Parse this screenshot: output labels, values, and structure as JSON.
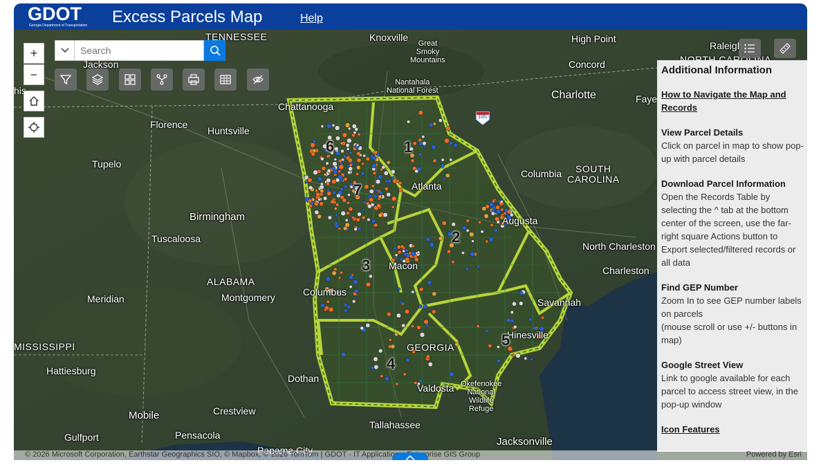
{
  "header": {
    "logo_text": "GDOT",
    "logo_sub": "Georgia Department of Transportation",
    "title": "Excess Parcels Map",
    "help_label": "Help"
  },
  "search": {
    "placeholder": "Search"
  },
  "zoom": {
    "in_label": "+",
    "out_label": "−"
  },
  "toolbar": {
    "tools": [
      "filter-icon",
      "layers-icon",
      "basemap-gallery-icon",
      "share-icon",
      "print-icon",
      "table-icon",
      "visibility-icon"
    ],
    "right_tools": [
      "list-icon",
      "measure-icon"
    ]
  },
  "map": {
    "cities": {
      "tennessee": "TENNESSEE",
      "knoxville": "Knoxville",
      "great_smoky": "Great\nSmoky\nMountains",
      "high_point": "High Point",
      "raleigh": "Raleigh",
      "north_carolina": "NORTH CAROLINA",
      "jackson": "Jackson",
      "concord": "Concord",
      "nantahala": "Nantahala\nNational Forest",
      "charlotte": "Charlotte",
      "fayetteville": "Faye",
      "chattanooga": "Chattanooga",
      "florence": "Florence",
      "huntsville": "Huntsville",
      "tupelo": "Tupelo",
      "columbia": "Columbia",
      "south_carolina": "SOUTH\nCAROLINA",
      "atlanta": "Atlanta",
      "birmingham": "Birmingham",
      "augusta": "Augusta",
      "tuscaloosa": "Tuscaloosa",
      "north_charleston": "North Charleston",
      "macon": "Macon",
      "charleston": "Charleston",
      "alabama": "ALABAMA",
      "montgomery": "Montgomery",
      "columbus": "Columbus",
      "meridian": "Meridian",
      "savannah": "Savannah",
      "mississippi": "MISSISSIPPI",
      "hinesville": "Hinesville",
      "georgia": "GEORGIA",
      "hattiesburg": "Hattiesburg",
      "dothan": "Dothan",
      "valdosta": "Valdosta",
      "okefenokee": "Okefenokee\nNational\nWildlife\nRefuge",
      "mobile": "Mobile",
      "crestview": "Crestview",
      "gulfport": "Gulfport",
      "pensacola": "Pensacola",
      "tallahassee": "Tallahassee",
      "jacksonville": "Jacksonville",
      "panama_city": "Panama City",
      "this": "his",
      "interstate": "185"
    },
    "districts": [
      "1",
      "2",
      "3",
      "4",
      "5",
      "6",
      "7"
    ]
  },
  "panel": {
    "title": "Additional Information",
    "nav_link": "How to Navigate the Map and Records",
    "sections": [
      {
        "heading": "View Parcel Details",
        "body": "Click on parcel in map to show pop-up with parcel details"
      },
      {
        "heading": "Download Parcel Information",
        "body": "Open the Records Table by selecting the ^ tab at the bottom center of the screen, use the far-right square Actions button to Export selected/filtered records or all data"
      },
      {
        "heading": "Find GEP Number",
        "body": "Zoom In to see GEP number labels on parcels\n(mouse scroll or use +/- buttons in map)"
      },
      {
        "heading": "Google Street View",
        "body": "Link to google available for each parcel to access street view, in the pop-up window"
      }
    ],
    "icon_link": "Icon Features"
  },
  "footer": {
    "attribution": "© 2026 Microsoft Corporation, Earthstar Geographics SIO, © Mapbox, © 2026 TomTom | GDOT - IT Applications, Enterprise GIS Group",
    "esri": "Powered by Esri"
  },
  "colors": {
    "header": "#0a3f9c",
    "accent": "#0a7ae0",
    "boundary": "#b8d43a",
    "parcel_orange": "#f26b21",
    "parcel_blue": "#2563d6"
  }
}
